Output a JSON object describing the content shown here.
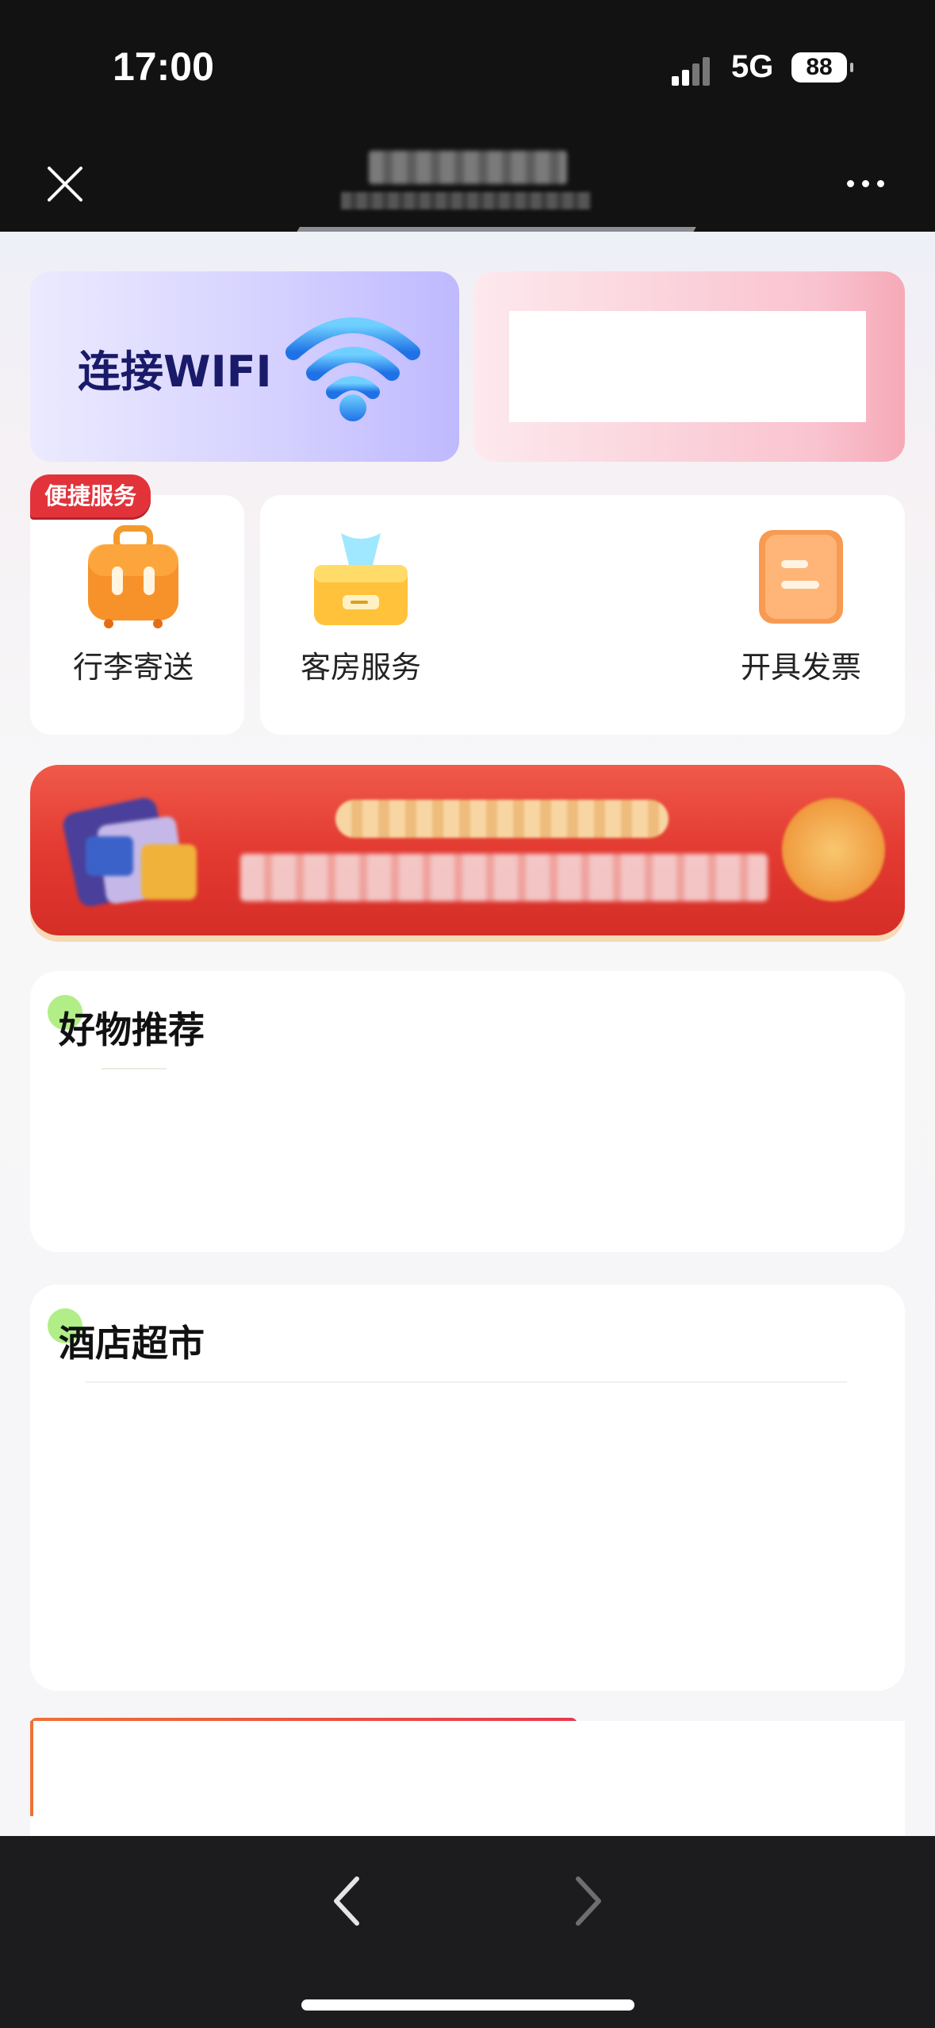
{
  "status_bar": {
    "time": "17:00",
    "network": "5G",
    "battery": "88"
  },
  "nav_bar": {
    "title": "",
    "subtitle": ""
  },
  "wifi_card": {
    "label": "连接WIFI"
  },
  "badge": {
    "label": "便捷服务"
  },
  "services": [
    {
      "label": "行李寄送",
      "icon": "luggage-icon"
    },
    {
      "label": "客房服务",
      "icon": "tissue-box-icon"
    },
    {
      "label": "开具发票",
      "icon": "invoice-icon"
    }
  ],
  "sections": {
    "goods": {
      "title": "好物推荐"
    },
    "market": {
      "title": "酒店超市"
    }
  },
  "colors": {
    "badge_red": "#e2333b",
    "banner_red": "#e33a31",
    "wifi_blue": "#2f8cf0",
    "accent_green": "#a8ec7a"
  }
}
